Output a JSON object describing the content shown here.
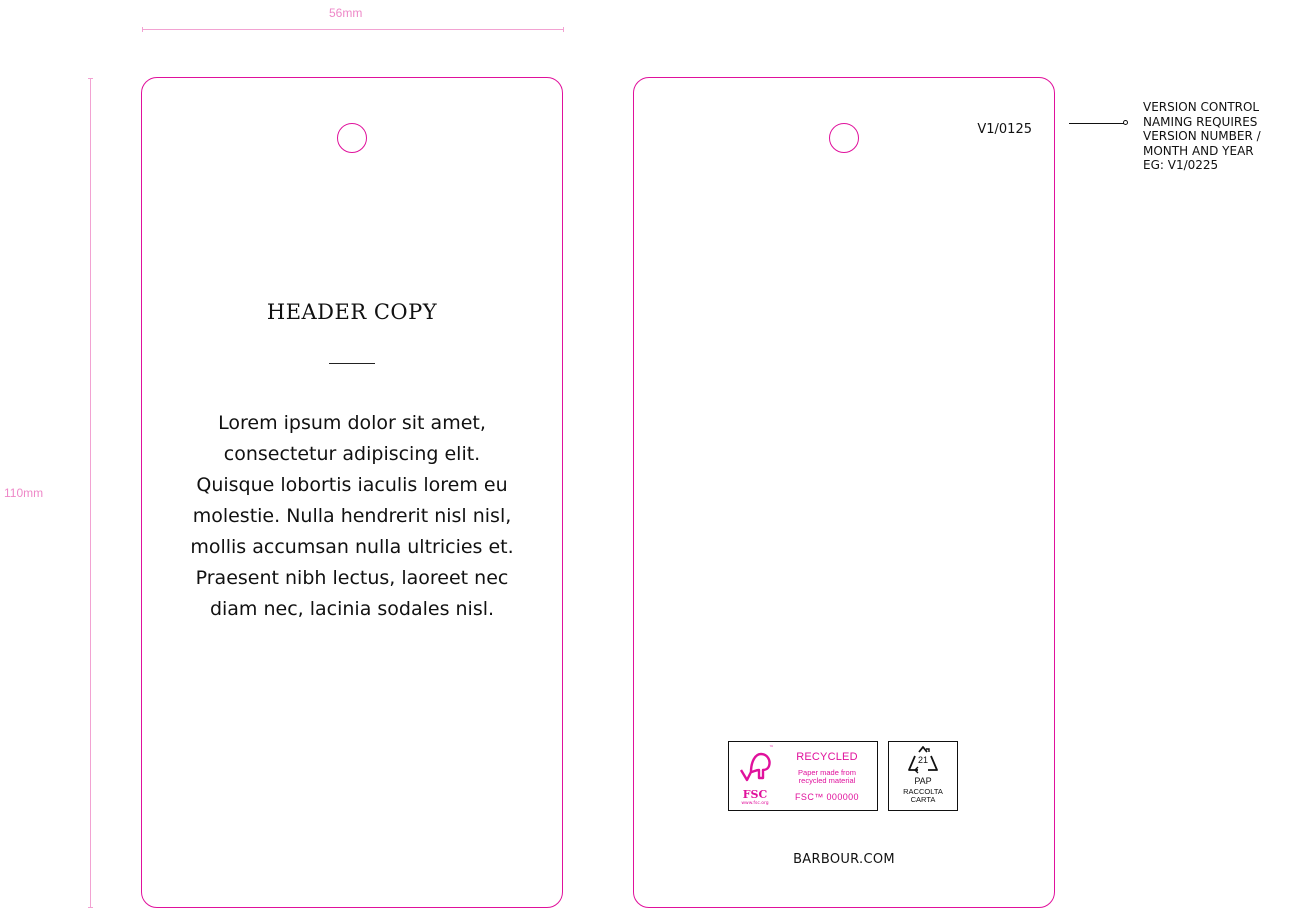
{
  "dimensions": {
    "width_label": "56mm",
    "height_label": "110mm"
  },
  "front": {
    "header": "HEADER COPY",
    "body": "Lorem ipsum dolor sit amet, consectetur adipiscing elit. Quisque lobortis iaculis lorem eu molestie. Nulla hendrerit nisl nisl, mollis accumsan nulla ultricies et. Praesent nibh lectus, laoreet nec diam nec, lacinia sodales nisl."
  },
  "back": {
    "version": "V1/0125",
    "website": "BARBOUR.COM",
    "fsc": {
      "brand": "FSC",
      "tm": "™",
      "url": "www.fsc.org",
      "label": "RECYCLED",
      "description_lines": [
        "Paper made from",
        "recycled material"
      ],
      "code": "FSC™ 000000"
    },
    "pap": {
      "number": "21",
      "label": "PAP",
      "description_lines": [
        "RACCOLTA",
        "CARTA"
      ]
    }
  },
  "callout": {
    "lines": [
      "VERSION CONTROL",
      "NAMING REQUIRES",
      "VERSION NUMBER /",
      "MONTH AND YEAR",
      "EG: V1/0225"
    ]
  },
  "colors": {
    "dieline": "#e0119c",
    "dimension": "#f2a2d2",
    "text": "#111111"
  }
}
